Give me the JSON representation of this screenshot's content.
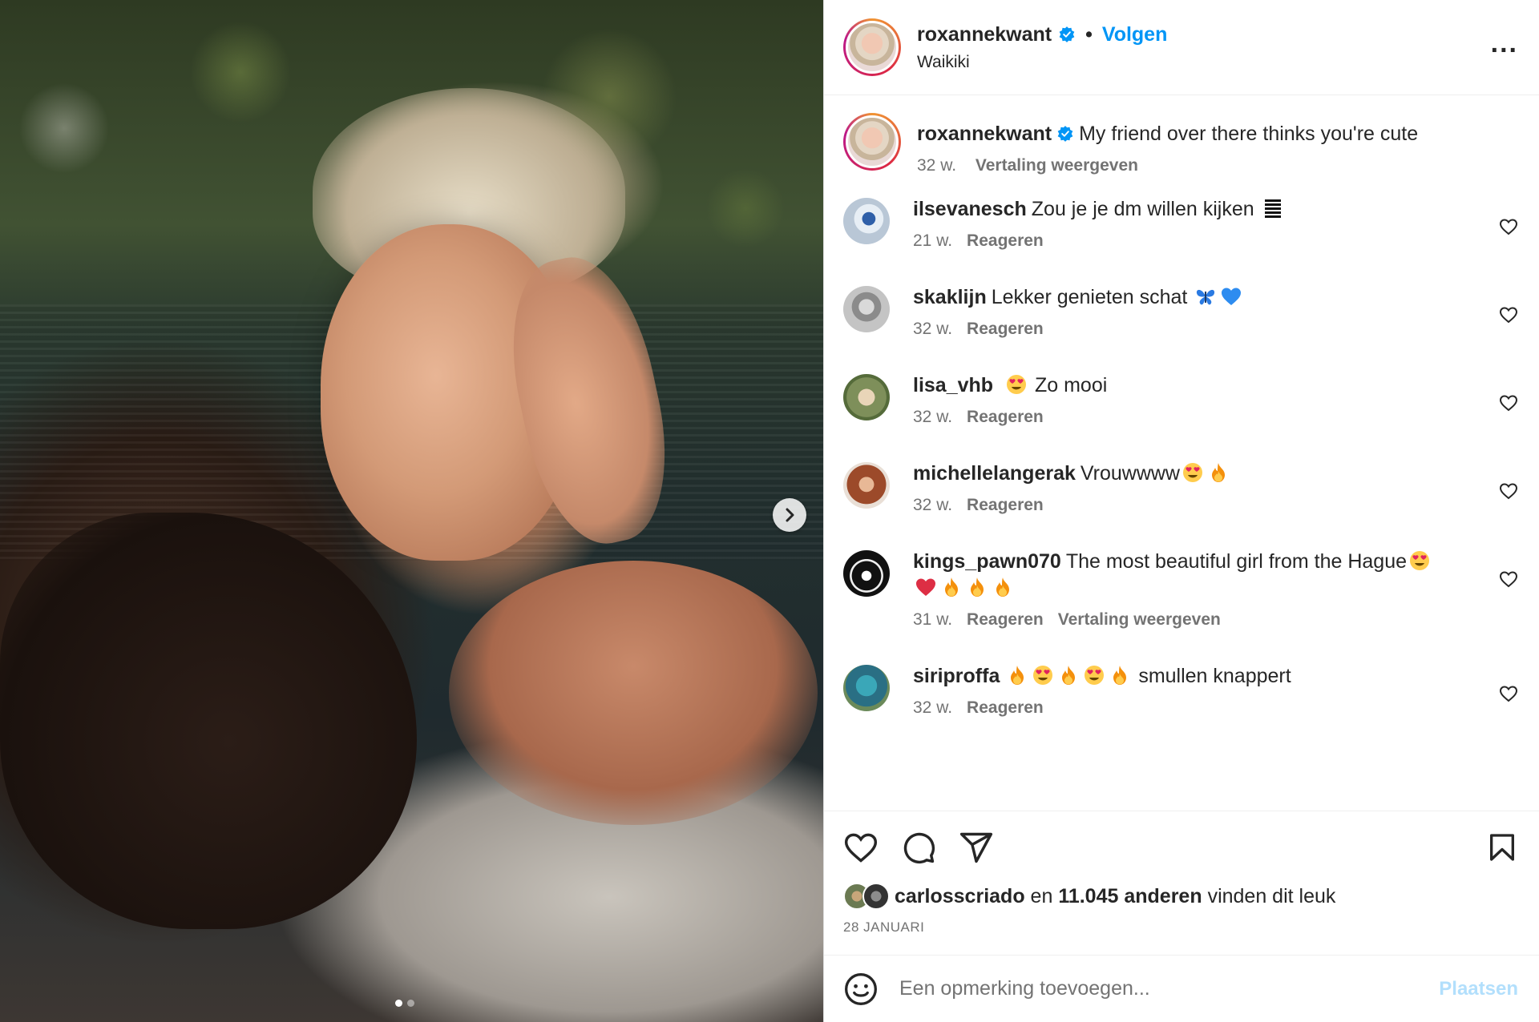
{
  "post": {
    "author": "roxannekwant",
    "follow_label": "Volgen",
    "separator": "•",
    "location": "Waikiki",
    "more_label": "..."
  },
  "caption": {
    "username": "roxannekwant",
    "text": "My friend over there thinks you're cute",
    "time": "32 w.",
    "translate": "Vertaling weergeven"
  },
  "comments": [
    {
      "username": "ilsevanesch",
      "text": "Zou je je dm willen kijken",
      "emojis": [
        "stack"
      ],
      "time": "21 w.",
      "reply": "Reageren"
    },
    {
      "username": "skaklijn",
      "text": "Lekker genieten schat",
      "emojis": [
        "butterfly",
        "blue-heart"
      ],
      "time": "32 w.",
      "reply": "Reageren"
    },
    {
      "username": "lisa_vhb",
      "text": "Zo mooi",
      "emojis_before": [
        "heart-eyes"
      ],
      "time": "32 w.",
      "reply": "Reageren"
    },
    {
      "username": "michellelangerak",
      "text": "Vrouwwww",
      "emojis": [
        "heart-eyes",
        "fire"
      ],
      "time": "32 w.",
      "reply": "Reageren"
    },
    {
      "username": "kings_pawn070",
      "text": "The most beautiful girl from the Hague",
      "emojis": [
        "heart-eyes",
        "red-heart",
        "fire",
        "fire",
        "fire"
      ],
      "time": "31 w.",
      "reply": "Reageren",
      "translate": "Vertaling weergeven"
    },
    {
      "username": "siriproffa",
      "text": "smullen knappert",
      "emojis_before": [
        "fire",
        "heart-eyes",
        "fire",
        "heart-eyes",
        "fire"
      ],
      "time": "32 w.",
      "reply": "Reageren"
    }
  ],
  "likes": {
    "user": "carlosscriado",
    "and": "en",
    "count": "11.045 anderen",
    "suffix": "vinden dit leuk",
    "date": "28 JANUARI"
  },
  "composer": {
    "placeholder": "Een opmerking toevoegen...",
    "post_label": "Plaatsen"
  },
  "icons": {
    "verified": "verified-badge-icon",
    "like": "heart-icon",
    "comment": "comment-icon",
    "share": "share-icon",
    "save": "bookmark-icon",
    "emoji": "emoji-icon",
    "next": "chevron-right-icon"
  },
  "colors": {
    "follow": "#0095f6",
    "verified": "#0095f6",
    "post_button_disabled": "#b2dffc",
    "muted": "#737373"
  },
  "carousel": {
    "total": 2,
    "active": 1
  }
}
